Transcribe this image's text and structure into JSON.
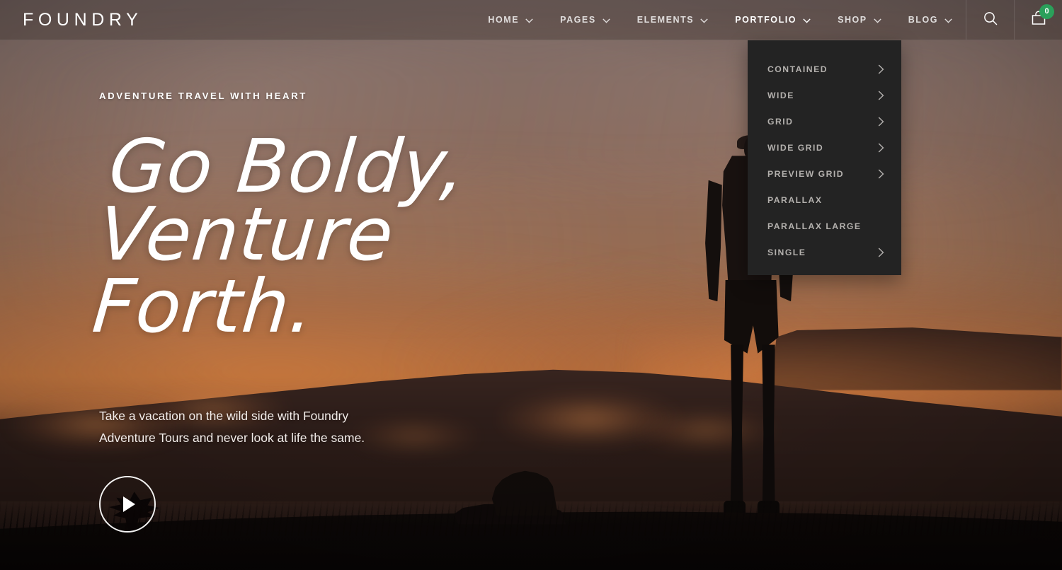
{
  "site": {
    "logo": "FOUNDRY",
    "accent_green": "#2aa05a",
    "dropdown_bg": "#232323"
  },
  "header": {
    "nav": [
      {
        "label": "HOME",
        "icon": "chevron-down-icon",
        "active": false
      },
      {
        "label": "PAGES",
        "icon": "chevron-down-icon",
        "active": false
      },
      {
        "label": "ELEMENTS",
        "icon": "chevron-down-icon",
        "active": false
      },
      {
        "label": "PORTFOLIO",
        "icon": "chevron-down-icon",
        "active": true
      },
      {
        "label": "SHOP",
        "icon": "chevron-down-icon",
        "active": false
      },
      {
        "label": "BLOG",
        "icon": "chevron-down-icon",
        "active": false
      }
    ],
    "search_icon": "search-icon",
    "cart_icon": "shopping-bag-icon",
    "cart_count": "0"
  },
  "dropdown": {
    "parent": "PORTFOLIO",
    "items": [
      {
        "label": "CONTAINED",
        "has_submenu": true
      },
      {
        "label": "WIDE",
        "has_submenu": true
      },
      {
        "label": "GRID",
        "has_submenu": true
      },
      {
        "label": "WIDE GRID",
        "has_submenu": true
      },
      {
        "label": "PREVIEW GRID",
        "has_submenu": true
      },
      {
        "label": "PARALLAX",
        "has_submenu": false
      },
      {
        "label": "PARALLAX LARGE",
        "has_submenu": false
      },
      {
        "label": "SINGLE",
        "has_submenu": true
      }
    ]
  },
  "hero": {
    "eyebrow": "ADVENTURE TRAVEL WITH HEART",
    "headline_line1": "Go Boldy,",
    "headline_line2": "Venture Forth.",
    "lede": "Take a vacation on the wild side with Foundry Adventure Tours and never look at life the same.",
    "play_icon": "play-icon"
  }
}
